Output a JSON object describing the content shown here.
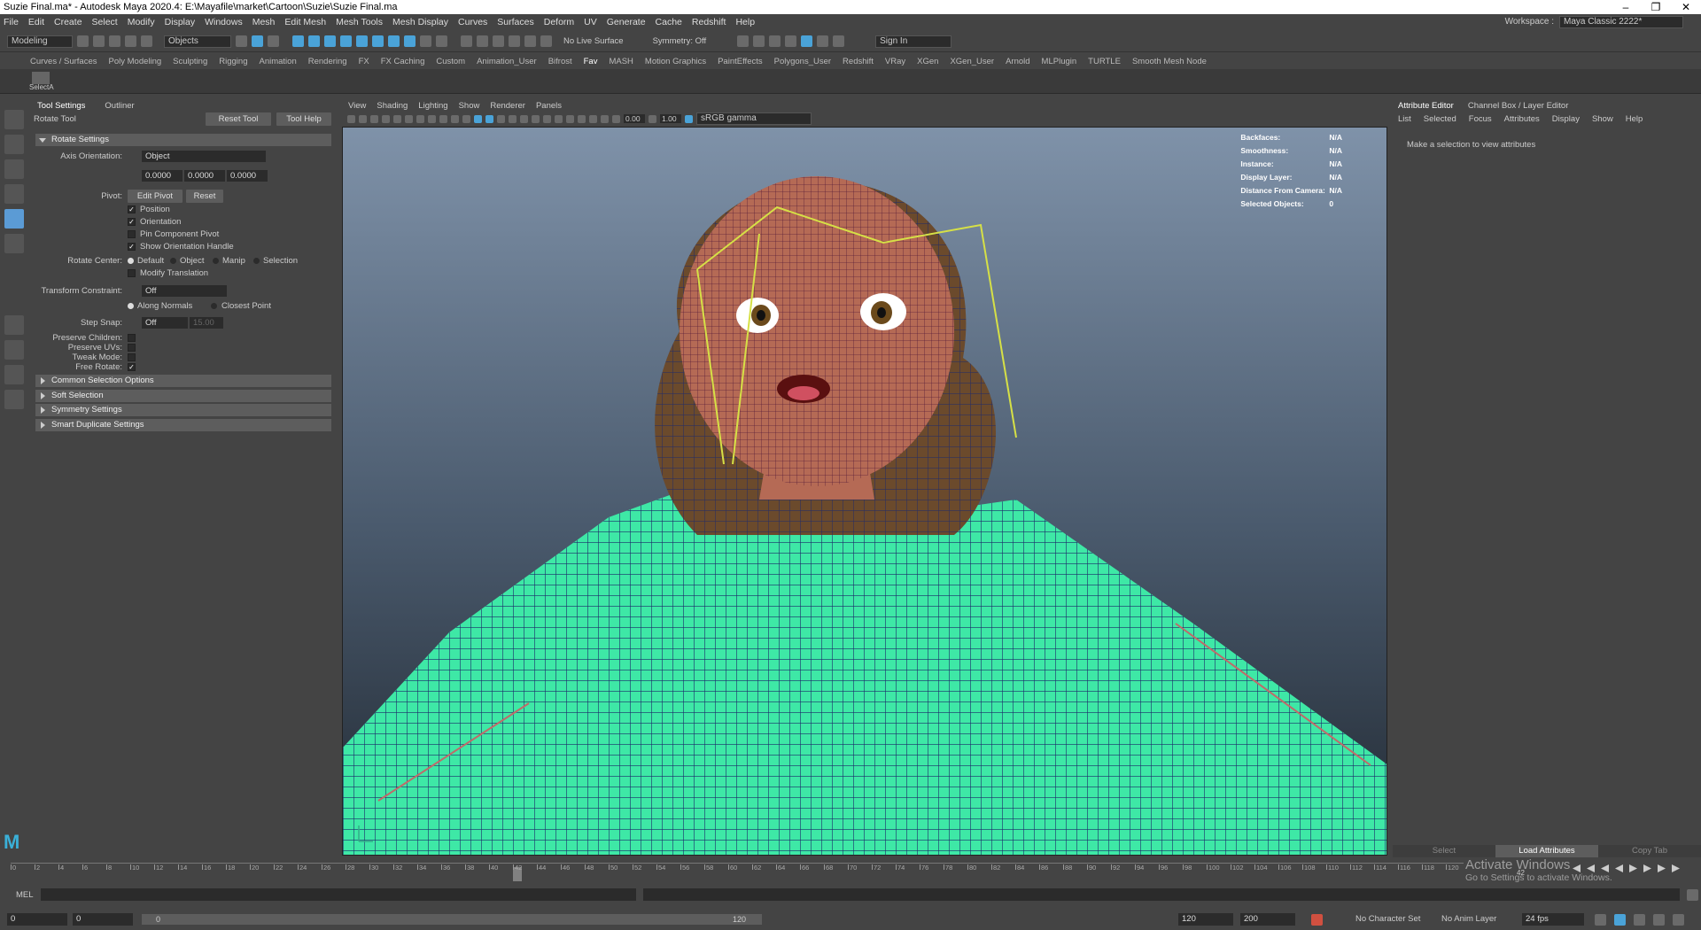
{
  "title": "Suzie Final.ma* - Autodesk Maya 2020.4: E:\\Mayafile\\market\\Cartoon\\Suzie\\Suzie Final.ma",
  "window_controls": [
    "–",
    "❐",
    "✕"
  ],
  "menus": [
    "File",
    "Edit",
    "Create",
    "Select",
    "Modify",
    "Display",
    "Windows",
    "Mesh",
    "Edit Mesh",
    "Mesh Tools",
    "Mesh Display",
    "Curves",
    "Surfaces",
    "Deform",
    "UV",
    "Generate",
    "Cache",
    "Redshift",
    "Help"
  ],
  "workspace": {
    "label": "Workspace :",
    "value": "Maya Classic 2222*"
  },
  "statusline": {
    "mode": "Modeling",
    "objects": "Objects",
    "live_surface": "No Live Surface",
    "symmetry": "Symmetry: Off",
    "sign_in": "Sign In"
  },
  "shelf_tabs": [
    "Curves / Surfaces",
    "Poly Modeling",
    "Sculpting",
    "Rigging",
    "Animation",
    "Rendering",
    "FX",
    "FX Caching",
    "Custom",
    "Animation_User",
    "Bifrost",
    "Fav",
    "MASH",
    "Motion Graphics",
    "PaintEffects",
    "Polygons_User",
    "Redshift",
    "VRay",
    "XGen",
    "XGen_User",
    "Arnold",
    "MLPlugin",
    "TURTLE",
    "Smooth Mesh Node"
  ],
  "active_shelf": "Fav",
  "shelf_item": "SelectA",
  "left_panel": {
    "tabs": [
      "Tool Settings",
      "Outliner"
    ],
    "tool_name": "Rotate Tool",
    "reset_tool": "Reset Tool",
    "tool_help": "Tool Help",
    "rotate_settings": "Rotate Settings",
    "axis_orientation_label": "Axis Orientation:",
    "axis_orientation_value": "Object",
    "axis_values": [
      "0.0000",
      "0.0000",
      "0.0000"
    ],
    "pivot_label": "Pivot:",
    "edit_pivot": "Edit Pivot",
    "reset": "Reset",
    "position": "Position",
    "orientation": "Orientation",
    "pin_component_pivot": "Pin Component Pivot",
    "show_orientation_handle": "Show Orientation Handle",
    "rotate_center_label": "Rotate Center:",
    "rotate_center_options": [
      "Default",
      "Object",
      "Manip",
      "Selection"
    ],
    "modify_translation": "Modify Translation",
    "transform_constraint_label": "Transform Constraint:",
    "transform_constraint_value": "Off",
    "along_normals": "Along Normals",
    "closest_point": "Closest Point",
    "step_snap_label": "Step Snap:",
    "step_snap_value": "Off",
    "step_snap_amount": "15.00",
    "preserve_children": "Preserve Children:",
    "preserve_uvs": "Preserve UVs:",
    "tweak_mode": "Tweak Mode:",
    "free_rotate": "Free Rotate:",
    "sections": [
      "Common Selection Options",
      "Soft Selection",
      "Symmetry Settings",
      "Smart Duplicate Settings"
    ]
  },
  "viewport": {
    "menus": [
      "View",
      "Shading",
      "Lighting",
      "Show",
      "Renderer",
      "Panels"
    ],
    "exposure": "0.00",
    "gamma": "1.00",
    "color_space": "sRGB gamma",
    "hud": [
      {
        "k": "Backfaces:",
        "v": "N/A"
      },
      {
        "k": "Smoothness:",
        "v": "N/A"
      },
      {
        "k": "Instance:",
        "v": "N/A"
      },
      {
        "k": "Display Layer:",
        "v": "N/A"
      },
      {
        "k": "Distance From Camera:",
        "v": "N/A"
      },
      {
        "k": "Selected Objects:",
        "v": "0"
      }
    ]
  },
  "attr": {
    "tabs": [
      "Attribute Editor",
      "Channel Box / Layer Editor"
    ],
    "menu": [
      "List",
      "Selected",
      "Focus",
      "Attributes",
      "Display",
      "Show",
      "Help"
    ],
    "message": "Make a selection to view attributes",
    "buttons": [
      "Select",
      "Load Attributes",
      "Copy Tab"
    ]
  },
  "timeline": {
    "ticks": [
      "0",
      "2",
      "4",
      "6",
      "8",
      "10",
      "12",
      "14",
      "16",
      "18",
      "20",
      "22",
      "24",
      "26",
      "28",
      "30",
      "32",
      "34",
      "36",
      "38",
      "40",
      "42",
      "44",
      "46",
      "48",
      "50",
      "52",
      "54",
      "56",
      "58",
      "60",
      "62",
      "64",
      "66",
      "68",
      "70",
      "72",
      "74",
      "76",
      "78",
      "80",
      "82",
      "84",
      "86",
      "88",
      "90",
      "92",
      "94",
      "96",
      "98",
      "100",
      "102",
      "104",
      "106",
      "108",
      "110",
      "112",
      "114",
      "116",
      "118",
      "120"
    ],
    "current": "42",
    "current_frac": 0.35,
    "end_value": "42"
  },
  "cmd": {
    "label": "MEL"
  },
  "range": {
    "start": "0",
    "inner_start": "0",
    "slider_start": "0",
    "slider_end": "120",
    "end": "120",
    "max": "200",
    "character_set": "No Character Set",
    "anim_layer": "No Anim Layer",
    "fps": "24 fps"
  },
  "activate": {
    "line1": "Activate Windows",
    "line2": "Go to Settings to activate Windows."
  },
  "colors": {
    "accent": "#5b9bd5",
    "mesh": "#3ee8a6",
    "skin": "#b56a55",
    "hair": "#6b4a2c",
    "wire": "#1c2a6a"
  }
}
